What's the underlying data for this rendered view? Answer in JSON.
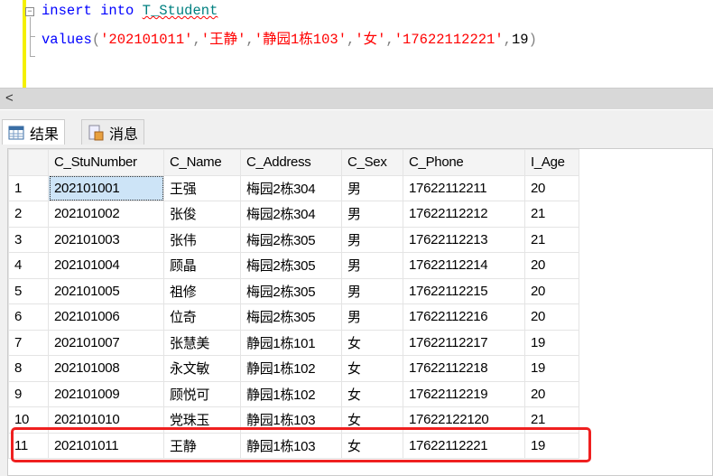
{
  "editor": {
    "line1": {
      "kw1": "insert",
      "kw2": "into",
      "table": "T_Student"
    },
    "line2": {
      "kw": "values",
      "open": "(",
      "v1": "'202101011'",
      "v2": "'王静'",
      "v3": "'静园1栋103'",
      "v4": "'女'",
      "v5": "'17622112221'",
      "v6": "19",
      "close": ")",
      "comma": ","
    }
  },
  "scroll": {
    "left_arrow": "<"
  },
  "tabs": [
    {
      "label": "结果"
    },
    {
      "label": "消息"
    }
  ],
  "grid": {
    "columns": [
      "",
      "C_StuNumber",
      "C_Name",
      "C_Address",
      "C_Sex",
      "C_Phone",
      "I_Age"
    ],
    "rows": [
      [
        "1",
        "202101001",
        "王强",
        "梅园2栋304",
        "男",
        "17622112211",
        "20"
      ],
      [
        "2",
        "202101002",
        "张俊",
        "梅园2栋304",
        "男",
        "17622112212",
        "21"
      ],
      [
        "3",
        "202101003",
        "张伟",
        "梅园2栋305",
        "男",
        "17622112213",
        "21"
      ],
      [
        "4",
        "202101004",
        "顾晶",
        "梅园2栋305",
        "男",
        "17622112214",
        "20"
      ],
      [
        "5",
        "202101005",
        "祖修",
        "梅园2栋305",
        "男",
        "17622112215",
        "20"
      ],
      [
        "6",
        "202101006",
        "位奇",
        "梅园2栋305",
        "男",
        "17622112216",
        "20"
      ],
      [
        "7",
        "202101007",
        "张慧美",
        "静园1栋101",
        "女",
        "17622112217",
        "19"
      ],
      [
        "8",
        "202101008",
        "永文敏",
        "静园1栋102",
        "女",
        "17622112218",
        "19"
      ],
      [
        "9",
        "202101009",
        "顾悦可",
        "静园1栋102",
        "女",
        "17622112219",
        "20"
      ],
      [
        "10",
        "202101010",
        "党珠玉",
        "静园1栋103",
        "女",
        "17622122120",
        "21"
      ],
      [
        "11",
        "202101011",
        "王静",
        "静园1栋103",
        "女",
        "17622112221",
        "19"
      ]
    ]
  },
  "highlight_color": "#ef2020"
}
